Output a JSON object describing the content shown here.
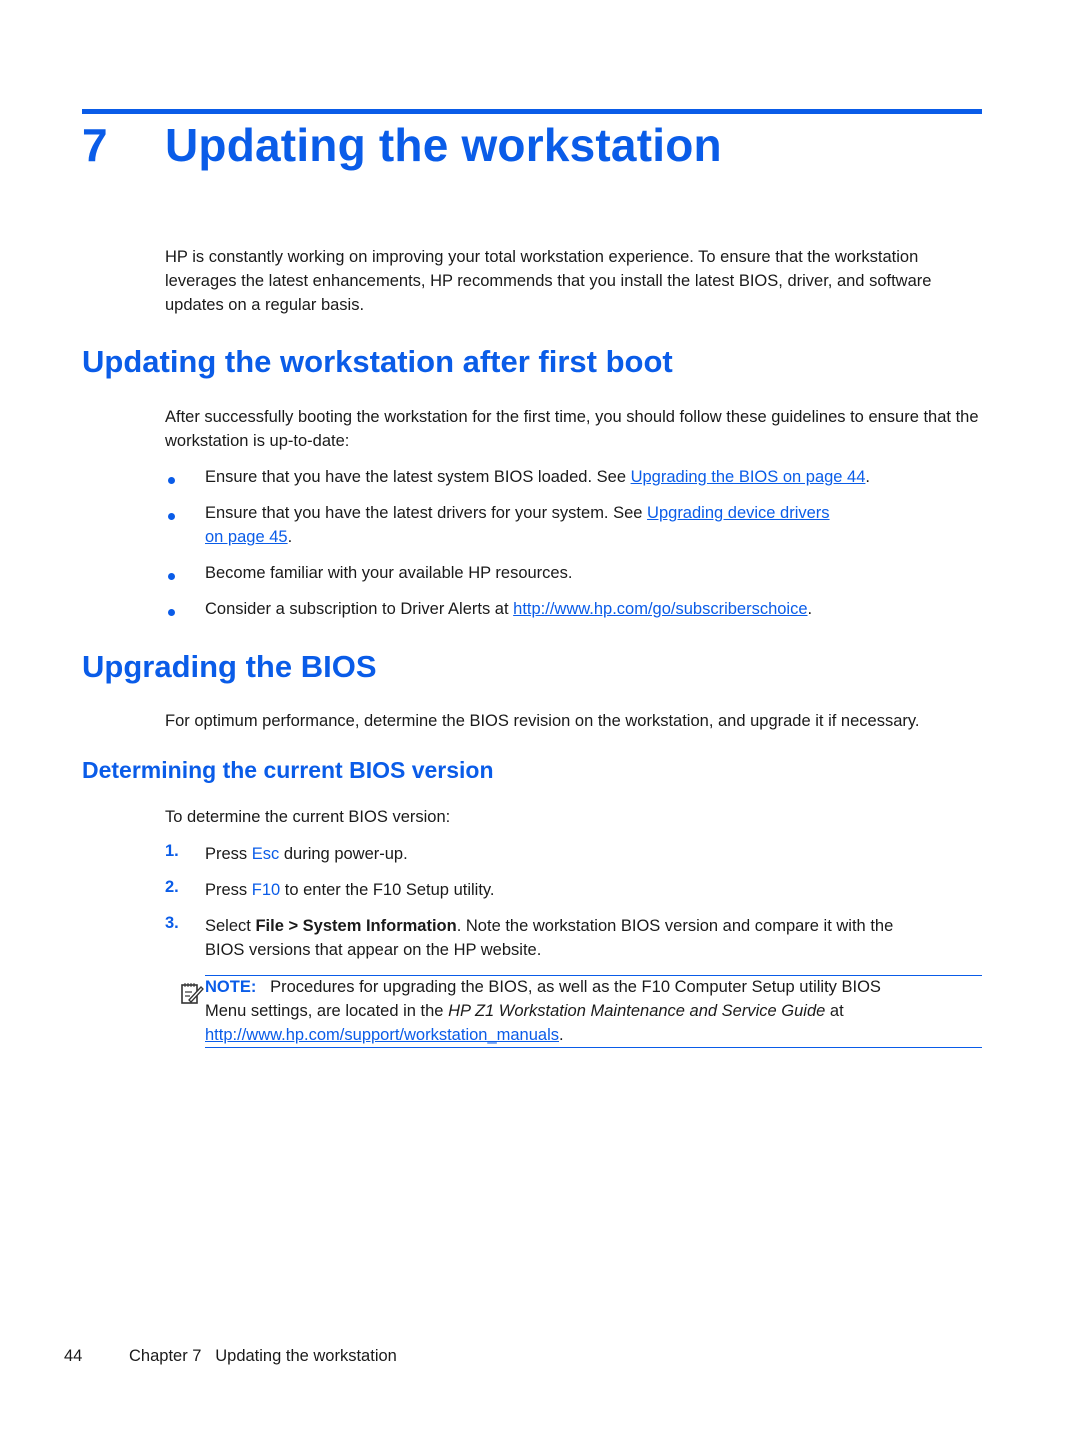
{
  "chapter": {
    "number": "7",
    "title": "Updating the workstation",
    "intro": "HP is constantly working on improving your total workstation experience. To ensure that the workstation leverages the latest enhancements, HP recommends that you install the latest BIOS, driver, and software updates on a regular basis."
  },
  "section_first_boot": {
    "heading": "Updating the workstation after first boot",
    "intro": "After successfully booting the workstation for the first time, you should follow these guidelines to ensure that the workstation is up-to-date:",
    "bullets": [
      {
        "text": "Ensure that you have the latest system BIOS loaded. See ",
        "link": "Upgrading the BIOS on page 44",
        "after": "."
      },
      {
        "text": "Ensure that you have the latest drivers for your system. See ",
        "link": "Upgrading device drivers",
        "link2": "on page 45",
        "after": "."
      },
      {
        "text": "Become familiar with your available HP resources."
      },
      {
        "text": "Consider a subscription to Driver Alerts at ",
        "link": "http://www.hp.com/go/subscriberschoice",
        "after": "."
      }
    ]
  },
  "section_bios": {
    "heading": "Upgrading the BIOS",
    "intro": "For optimum performance, determine the BIOS revision on the workstation, and upgrade it if necessary.",
    "subsection": {
      "heading": "Determining the current BIOS version",
      "intro": "To determine the current BIOS version:",
      "steps": [
        {
          "num": "1.",
          "pre": "Press ",
          "key": "Esc",
          "post": " during power-up."
        },
        {
          "num": "2.",
          "pre": "Press ",
          "key": "F10",
          "post": " to enter the F10 Setup utility."
        },
        {
          "num": "3.",
          "pre": "Select ",
          "bold": "File > System Information",
          "post": ". Note the workstation BIOS version and compare it with the",
          "line2": "BIOS versions that appear on the HP website."
        }
      ],
      "note": {
        "label": "NOTE:",
        "text1": "Procedures for upgrading the BIOS, as well as the F10 Computer Setup utility BIOS",
        "text2_pre": "Menu settings, are located in the ",
        "text2_italic": "HP Z1 Workstation Maintenance and Service Guide",
        "text2_post": " at",
        "link": "http://www.hp.com/support/workstation_manuals",
        "after": "."
      }
    }
  },
  "footer": {
    "page_number": "44",
    "chapter_label": "Chapter 7",
    "chapter_title": "Updating the workstation"
  }
}
